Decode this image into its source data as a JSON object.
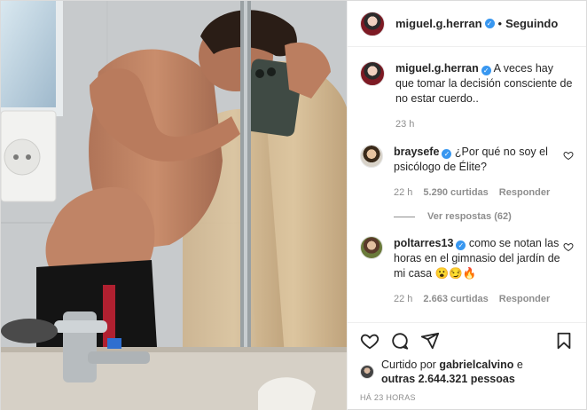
{
  "header": {
    "username": "miguel.g.herran",
    "separator": "•",
    "follow_label": "Seguindo"
  },
  "caption": {
    "username": "miguel.g.herran",
    "text": "A veces hay que tomar la decisión consciente de no estar cuerdo..",
    "time": "23 h"
  },
  "comments": [
    {
      "username": "braysefe",
      "text": "¿Por qué no soy el psicólogo de Élite?",
      "time": "22 h",
      "likes": "5.290 curtidas",
      "reply_label": "Responder",
      "view_replies": "Ver respostas (62)"
    },
    {
      "username": "poltarres13",
      "text": "como se notan las horas en el gimnasio del jardín de mi casa 😮😏🔥",
      "time": "22 h",
      "likes": "2.663 curtidas",
      "reply_label": "Responder"
    }
  ],
  "likes": {
    "prefix": "Curtido por",
    "user": "gabrielcalvino",
    "middle": "e",
    "others": "outras 2.644.321 pessoas"
  },
  "timestamp": "HÁ 23 HORAS",
  "icons": {
    "like": "heart-icon",
    "comment": "comment-icon",
    "share": "share-icon",
    "save": "bookmark-icon",
    "verified": "verified-badge-icon"
  },
  "colors": {
    "verified": "#3897f0",
    "muted": "#8e8e8e",
    "text": "#262626",
    "border": "#dbdbdb"
  }
}
